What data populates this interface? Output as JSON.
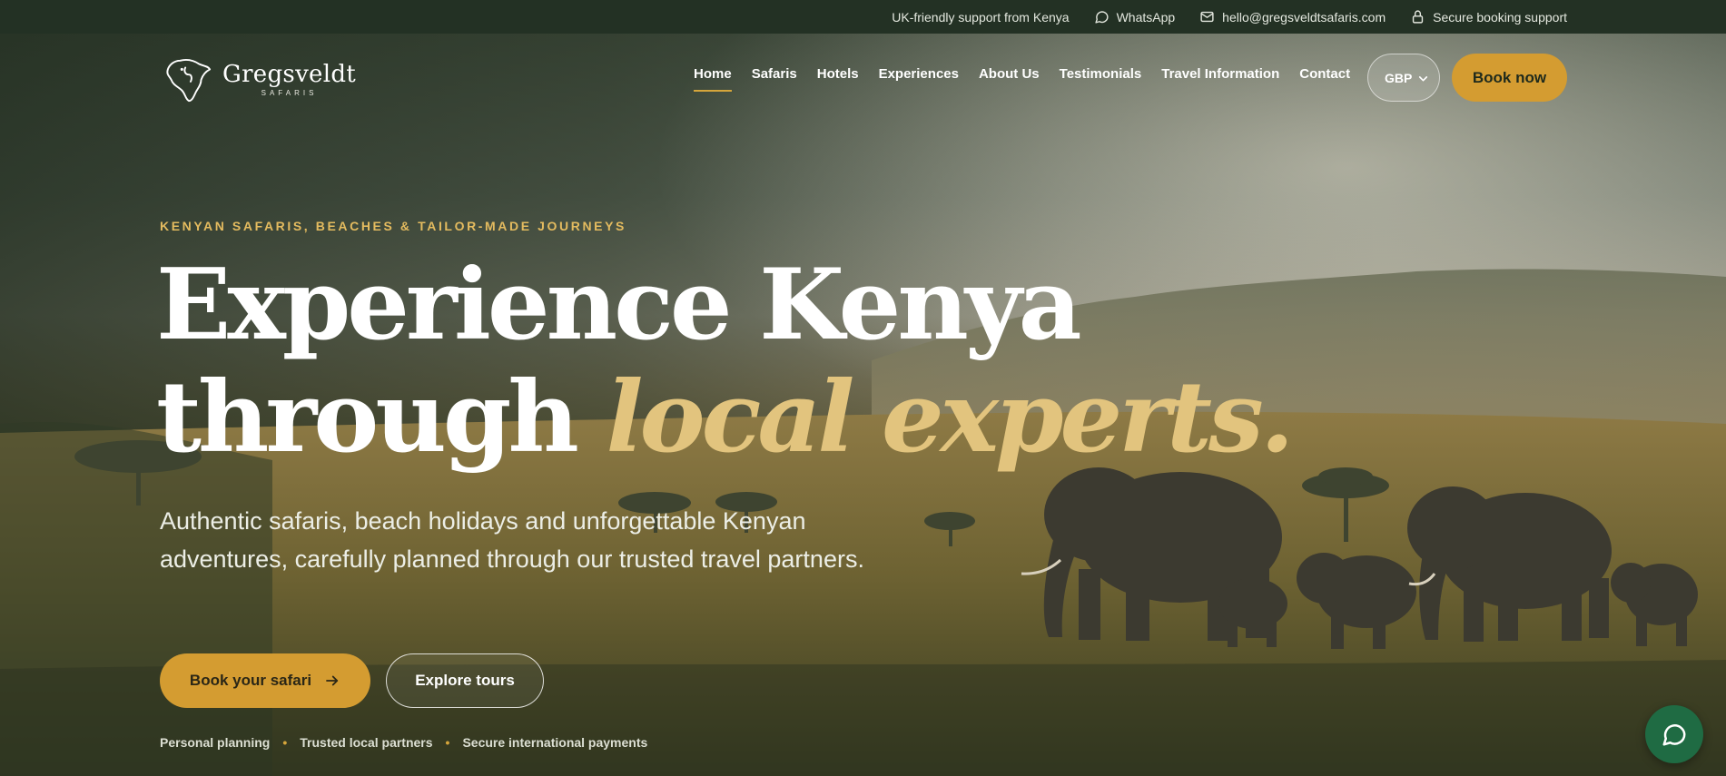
{
  "topbar": {
    "support_text": "UK-friendly support from Kenya",
    "whatsapp_label": "WhatsApp",
    "email": "hello@gregsveldtsafaris.com",
    "secure_label": "Secure booking support"
  },
  "header": {
    "logo_name": "Gregsveldt",
    "logo_sub": "SAFARIS",
    "nav": [
      {
        "label": "Home",
        "active": true
      },
      {
        "label": "Safaris"
      },
      {
        "label": "Hotels"
      },
      {
        "label": "Experiences"
      },
      {
        "label": "About Us"
      },
      {
        "label": "Testimonials"
      },
      {
        "label": "Travel Information"
      },
      {
        "label": "Contact"
      }
    ],
    "currency": "GBP",
    "book_now": "Book now"
  },
  "hero": {
    "eyebrow": "KENYAN SAFARIS, BEACHES & TAILOR-MADE JOURNEYS",
    "headline_line1": "Experience Kenya",
    "headline_line2_plain": "through",
    "headline_line2_accent": "local experts.",
    "subcopy": "Authentic safaris, beach holidays and unforgettable Kenyan adventures, carefully planned through our trusted travel partners.",
    "primary_cta": "Book your safari",
    "secondary_cta": "Explore tours",
    "trust_points": [
      "Personal planning",
      "Trusted local partners",
      "Secure international payments"
    ]
  },
  "icons": {
    "whatsapp": "speech-bubble-icon",
    "email": "envelope-icon",
    "secure": "lock-icon",
    "chevron": "chevron-down-icon",
    "arrow": "arrow-right-icon",
    "chat": "chat-icon"
  },
  "colors": {
    "accent_gold": "#d49c31",
    "headline_accent": "#e2c47e",
    "topbar_bg": "#233124",
    "chat_green": "#1f6b43"
  }
}
